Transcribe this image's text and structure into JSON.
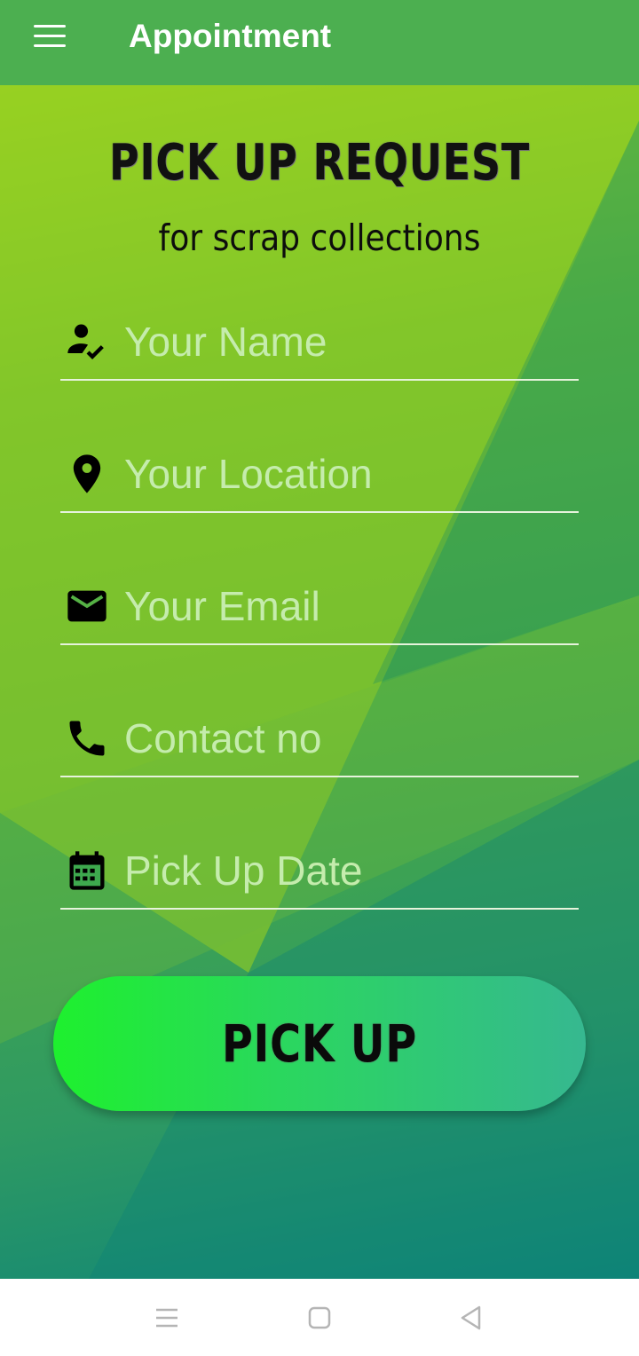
{
  "appbar": {
    "title": "Appointment",
    "menu_icon": "hamburger-menu-icon"
  },
  "form": {
    "heading": "PICK UP REQUEST",
    "subheading": "for scrap collections",
    "fields": [
      {
        "name": "name",
        "icon": "person-check-icon",
        "placeholder": "Your Name",
        "value": ""
      },
      {
        "name": "location",
        "icon": "location-pin-icon",
        "placeholder": "Your Location",
        "value": ""
      },
      {
        "name": "email",
        "icon": "mail-icon",
        "placeholder": "Your Email",
        "value": ""
      },
      {
        "name": "contact",
        "icon": "phone-icon",
        "placeholder": "Contact no",
        "value": ""
      },
      {
        "name": "date",
        "icon": "calendar-icon",
        "placeholder": "Pick Up Date",
        "value": ""
      }
    ],
    "submit_label": "PICK UP"
  },
  "system_nav": {
    "items": [
      "recents-icon",
      "home-icon",
      "back-icon"
    ]
  },
  "colors": {
    "appbar": "#4caf50",
    "button_start": "#1ef02e",
    "button_end": "#36b890",
    "placeholder": "#c5ecad"
  }
}
